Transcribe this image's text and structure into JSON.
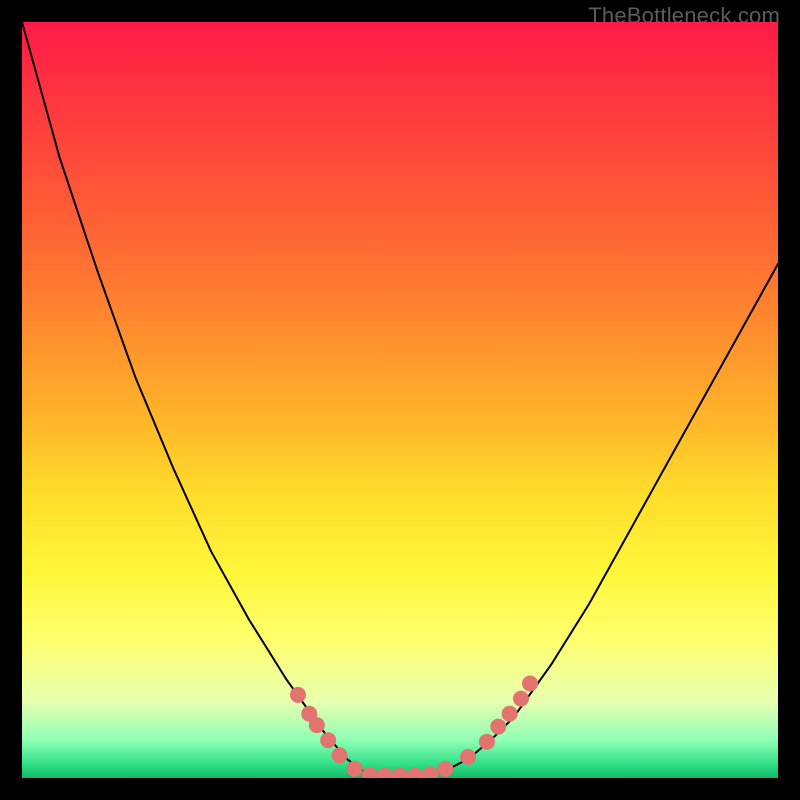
{
  "watermark": "TheBottleneck.com",
  "chart_data": {
    "type": "line",
    "title": "",
    "xlabel": "",
    "ylabel": "",
    "xlim": [
      0,
      1
    ],
    "ylim": [
      0,
      1
    ],
    "grid": false,
    "legend": false,
    "series": [
      {
        "name": "curve",
        "color": "#000000",
        "x": [
          0.0,
          0.05,
          0.1,
          0.15,
          0.2,
          0.25,
          0.3,
          0.35,
          0.4,
          0.43,
          0.45,
          0.47,
          0.5,
          0.53,
          0.56,
          0.59,
          0.62,
          0.65,
          0.7,
          0.75,
          0.8,
          0.85,
          0.9,
          0.95,
          1.0
        ],
        "y": [
          1.0,
          0.82,
          0.67,
          0.53,
          0.41,
          0.3,
          0.21,
          0.13,
          0.06,
          0.025,
          0.01,
          0.003,
          0.003,
          0.003,
          0.01,
          0.025,
          0.05,
          0.08,
          0.15,
          0.23,
          0.32,
          0.41,
          0.5,
          0.59,
          0.68
        ]
      },
      {
        "name": "left-dots",
        "type": "scatter",
        "color": "#e2736f",
        "x": [
          0.365,
          0.38,
          0.39,
          0.405,
          0.42,
          0.44
        ],
        "y": [
          0.11,
          0.085,
          0.07,
          0.05,
          0.03,
          0.012
        ]
      },
      {
        "name": "bottom-dots",
        "type": "scatter",
        "color": "#e2736f",
        "x": [
          0.46,
          0.48,
          0.5,
          0.52,
          0.54,
          0.56
        ],
        "y": [
          0.004,
          0.003,
          0.003,
          0.003,
          0.005,
          0.012
        ]
      },
      {
        "name": "right-dots",
        "type": "scatter",
        "color": "#e2736f",
        "x": [
          0.59,
          0.615,
          0.63,
          0.645,
          0.66,
          0.672
        ],
        "y": [
          0.028,
          0.048,
          0.068,
          0.085,
          0.105,
          0.125
        ]
      }
    ],
    "background_gradient": {
      "direction": "top-to-bottom",
      "stops": [
        {
          "pos": 0.0,
          "color": "#ff1a47"
        },
        {
          "pos": 0.3,
          "color": "#ff6a33"
        },
        {
          "pos": 0.6,
          "color": "#ffdb2a"
        },
        {
          "pos": 0.82,
          "color": "#feff70"
        },
        {
          "pos": 0.95,
          "color": "#8dffb5"
        },
        {
          "pos": 1.0,
          "color": "#0fb965"
        }
      ]
    }
  }
}
